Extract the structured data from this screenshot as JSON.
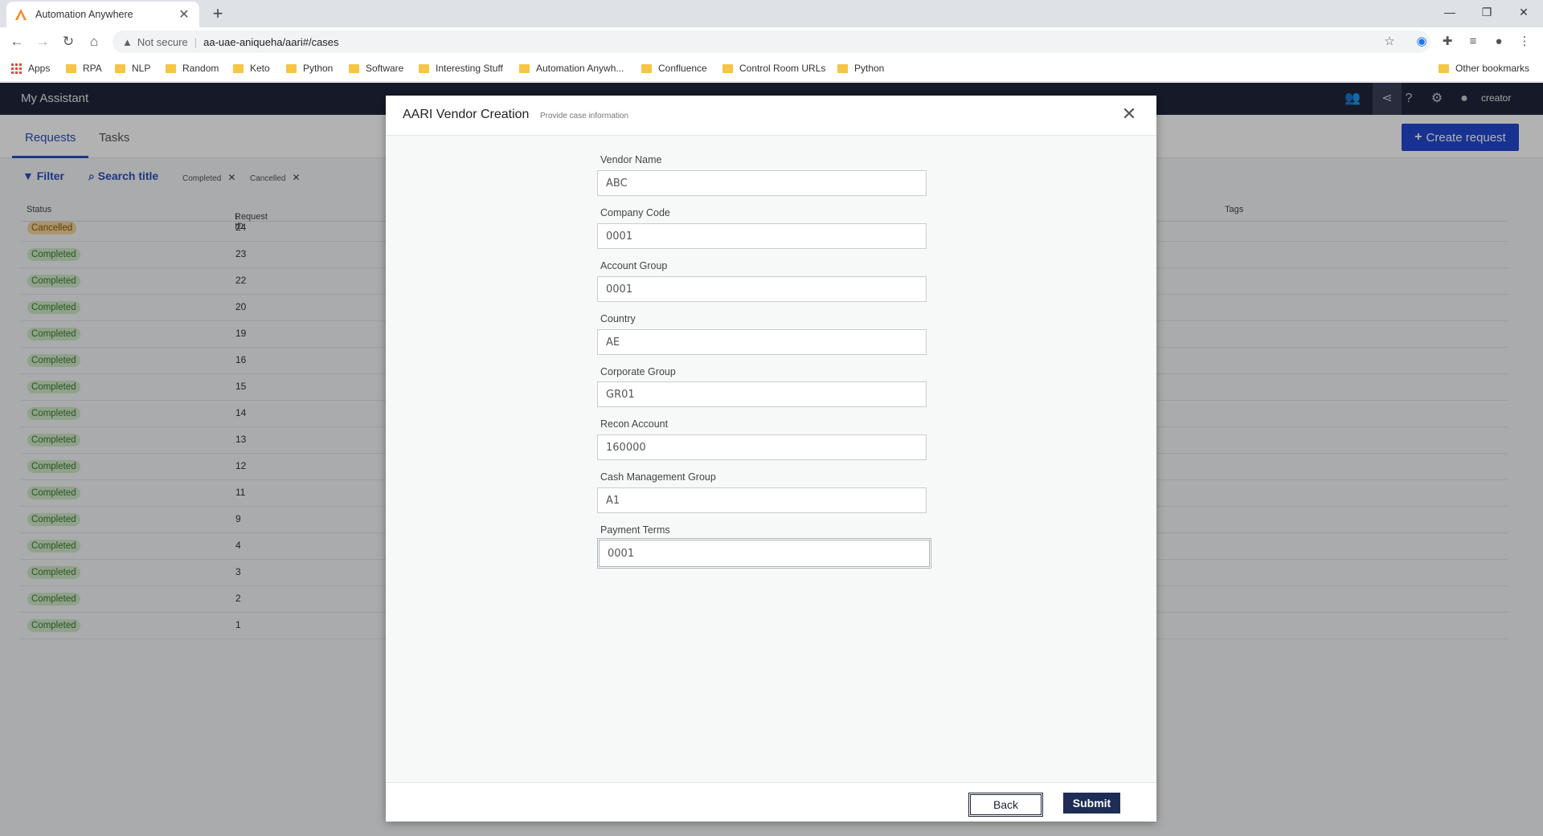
{
  "browser": {
    "tab_title": "Automation Anywhere",
    "not_secure": "Not secure",
    "url": "aa-uae-aniqueha/aari#/cases",
    "bookmarks": [
      "Apps",
      "RPA",
      "NLP",
      "Random",
      "Keto",
      "Python",
      "Software",
      "Interesting Stuff",
      "Automation Anywh...",
      "Confluence",
      "Control Room URLs",
      "Python"
    ],
    "other_bookmarks": "Other bookmarks"
  },
  "app": {
    "title": "My Assistant",
    "user": "creator",
    "tabs": [
      "Requests",
      "Tasks"
    ],
    "create_label": "Create request",
    "filter_label": "Filter",
    "search_label": "Search title",
    "chips": [
      "Completed",
      "Cancelled"
    ],
    "columns": {
      "status": "Status",
      "request_id": "Request ID",
      "request_id_sort": "↓",
      "tags": "Tags"
    },
    "rows": [
      {
        "status": "Cancelled",
        "id": "24"
      },
      {
        "status": "Completed",
        "id": "23"
      },
      {
        "status": "Completed",
        "id": "22"
      },
      {
        "status": "Completed",
        "id": "20"
      },
      {
        "status": "Completed",
        "id": "19"
      },
      {
        "status": "Completed",
        "id": "16"
      },
      {
        "status": "Completed",
        "id": "15"
      },
      {
        "status": "Completed",
        "id": "14"
      },
      {
        "status": "Completed",
        "id": "13"
      },
      {
        "status": "Completed",
        "id": "12"
      },
      {
        "status": "Completed",
        "id": "11"
      },
      {
        "status": "Completed",
        "id": "9"
      },
      {
        "status": "Completed",
        "id": "4"
      },
      {
        "status": "Completed",
        "id": "3"
      },
      {
        "status": "Completed",
        "id": "2"
      },
      {
        "status": "Completed",
        "id": "1"
      }
    ]
  },
  "modal": {
    "title": "AARI Vendor Creation",
    "subtitle": "Provide case information",
    "fields": [
      {
        "label": "Vendor Name",
        "value": "ABC"
      },
      {
        "label": "Company Code",
        "value": "0001"
      },
      {
        "label": "Account Group",
        "value": "0001"
      },
      {
        "label": "Country",
        "value": "AE"
      },
      {
        "label": "Corporate Group",
        "value": "GR01"
      },
      {
        "label": "Recon Account",
        "value": "160000"
      },
      {
        "label": "Cash Management Group",
        "value": "A1"
      },
      {
        "label": "Payment Terms",
        "value": "0001"
      }
    ],
    "back_label": "Back",
    "submit_label": "Submit"
  },
  "colors": {
    "header": "#20263a",
    "accent": "#2248d0",
    "submit": "#1d2d55"
  }
}
